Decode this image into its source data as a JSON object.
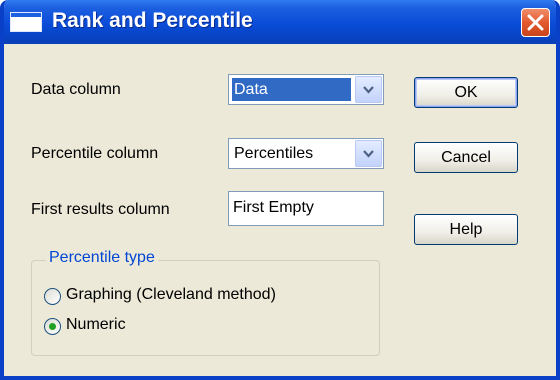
{
  "window": {
    "title": "Rank and Percentile",
    "icons": {
      "app": "window-icon",
      "close": "close-icon"
    }
  },
  "form": {
    "data_column": {
      "label": "Data column",
      "value": "Data"
    },
    "percentile_column": {
      "label": "Percentile column",
      "value": "Percentiles"
    },
    "first_results_column": {
      "label": "First results column",
      "value": "First Empty"
    }
  },
  "buttons": {
    "ok": "OK",
    "cancel": "Cancel",
    "help": "Help"
  },
  "percentile_type": {
    "legend": "Percentile type",
    "options": [
      {
        "label": "Graphing (Cleveland method)",
        "checked": false
      },
      {
        "label": "Numeric",
        "checked": true
      }
    ]
  },
  "colors": {
    "titlebar": "#0a4cd8",
    "dialog_bg": "#ece9d8",
    "selection": "#316ac5",
    "group_legend": "#0046d5",
    "close_button": "#e35a2f"
  }
}
